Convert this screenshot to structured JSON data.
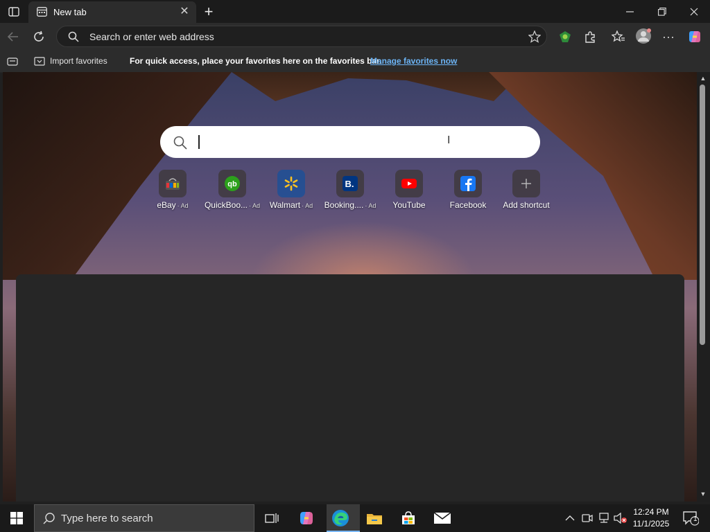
{
  "browser": {
    "tab_title": "New tab",
    "address_placeholder": "Search or enter web address"
  },
  "favorites_bar": {
    "import_label": "Import favorites",
    "message": "For quick access, place your favorites here on the favorites bar.",
    "manage_link": "Manage favorites now"
  },
  "shortcuts": [
    {
      "label": "eBay",
      "ad": "· Ad",
      "icon": "ebay-icon"
    },
    {
      "label": "QuickBoo...",
      "ad": "· Ad",
      "icon": "quickbooks-icon"
    },
    {
      "label": "Walmart",
      "ad": "· Ad",
      "icon": "walmart-icon"
    },
    {
      "label": "Booking....",
      "ad": "· Ad",
      "icon": "booking-icon"
    },
    {
      "label": "YouTube",
      "ad": "",
      "icon": "youtube-icon"
    },
    {
      "label": "Facebook",
      "ad": "",
      "icon": "facebook-icon"
    },
    {
      "label": "Add shortcut",
      "ad": "",
      "icon": "plus-icon"
    }
  ],
  "taskbar": {
    "search_placeholder": "Type here to search",
    "time": "12:24 PM",
    "date": "11/1/2025",
    "notification_count": "1"
  },
  "colors": {
    "accent": "#7ab8f5",
    "link": "#6cb4f5"
  }
}
